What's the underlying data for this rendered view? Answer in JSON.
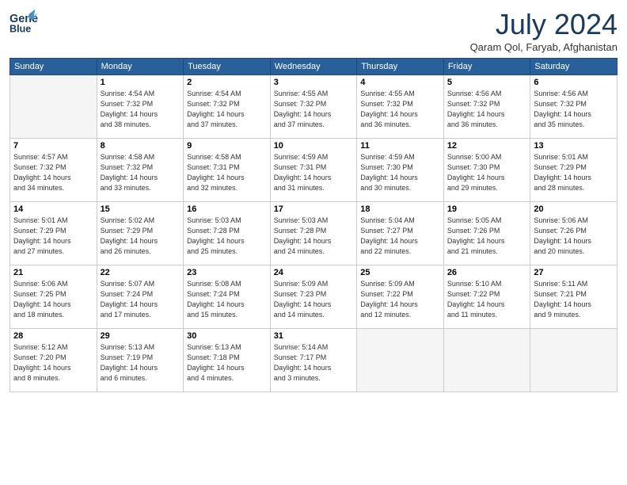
{
  "header": {
    "logo_top": "General",
    "logo_bottom": "Blue",
    "month_year": "July 2024",
    "location": "Qaram Qol, Faryab, Afghanistan"
  },
  "days_of_week": [
    "Sunday",
    "Monday",
    "Tuesday",
    "Wednesday",
    "Thursday",
    "Friday",
    "Saturday"
  ],
  "weeks": [
    [
      {
        "num": "",
        "info": ""
      },
      {
        "num": "1",
        "info": "Sunrise: 4:54 AM\nSunset: 7:32 PM\nDaylight: 14 hours\nand 38 minutes."
      },
      {
        "num": "2",
        "info": "Sunrise: 4:54 AM\nSunset: 7:32 PM\nDaylight: 14 hours\nand 37 minutes."
      },
      {
        "num": "3",
        "info": "Sunrise: 4:55 AM\nSunset: 7:32 PM\nDaylight: 14 hours\nand 37 minutes."
      },
      {
        "num": "4",
        "info": "Sunrise: 4:55 AM\nSunset: 7:32 PM\nDaylight: 14 hours\nand 36 minutes."
      },
      {
        "num": "5",
        "info": "Sunrise: 4:56 AM\nSunset: 7:32 PM\nDaylight: 14 hours\nand 36 minutes."
      },
      {
        "num": "6",
        "info": "Sunrise: 4:56 AM\nSunset: 7:32 PM\nDaylight: 14 hours\nand 35 minutes."
      }
    ],
    [
      {
        "num": "7",
        "info": "Sunrise: 4:57 AM\nSunset: 7:32 PM\nDaylight: 14 hours\nand 34 minutes."
      },
      {
        "num": "8",
        "info": "Sunrise: 4:58 AM\nSunset: 7:32 PM\nDaylight: 14 hours\nand 33 minutes."
      },
      {
        "num": "9",
        "info": "Sunrise: 4:58 AM\nSunset: 7:31 PM\nDaylight: 14 hours\nand 32 minutes."
      },
      {
        "num": "10",
        "info": "Sunrise: 4:59 AM\nSunset: 7:31 PM\nDaylight: 14 hours\nand 31 minutes."
      },
      {
        "num": "11",
        "info": "Sunrise: 4:59 AM\nSunset: 7:30 PM\nDaylight: 14 hours\nand 30 minutes."
      },
      {
        "num": "12",
        "info": "Sunrise: 5:00 AM\nSunset: 7:30 PM\nDaylight: 14 hours\nand 29 minutes."
      },
      {
        "num": "13",
        "info": "Sunrise: 5:01 AM\nSunset: 7:29 PM\nDaylight: 14 hours\nand 28 minutes."
      }
    ],
    [
      {
        "num": "14",
        "info": "Sunrise: 5:01 AM\nSunset: 7:29 PM\nDaylight: 14 hours\nand 27 minutes."
      },
      {
        "num": "15",
        "info": "Sunrise: 5:02 AM\nSunset: 7:29 PM\nDaylight: 14 hours\nand 26 minutes."
      },
      {
        "num": "16",
        "info": "Sunrise: 5:03 AM\nSunset: 7:28 PM\nDaylight: 14 hours\nand 25 minutes."
      },
      {
        "num": "17",
        "info": "Sunrise: 5:03 AM\nSunset: 7:28 PM\nDaylight: 14 hours\nand 24 minutes."
      },
      {
        "num": "18",
        "info": "Sunrise: 5:04 AM\nSunset: 7:27 PM\nDaylight: 14 hours\nand 22 minutes."
      },
      {
        "num": "19",
        "info": "Sunrise: 5:05 AM\nSunset: 7:26 PM\nDaylight: 14 hours\nand 21 minutes."
      },
      {
        "num": "20",
        "info": "Sunrise: 5:06 AM\nSunset: 7:26 PM\nDaylight: 14 hours\nand 20 minutes."
      }
    ],
    [
      {
        "num": "21",
        "info": "Sunrise: 5:06 AM\nSunset: 7:25 PM\nDaylight: 14 hours\nand 18 minutes."
      },
      {
        "num": "22",
        "info": "Sunrise: 5:07 AM\nSunset: 7:24 PM\nDaylight: 14 hours\nand 17 minutes."
      },
      {
        "num": "23",
        "info": "Sunrise: 5:08 AM\nSunset: 7:24 PM\nDaylight: 14 hours\nand 15 minutes."
      },
      {
        "num": "24",
        "info": "Sunrise: 5:09 AM\nSunset: 7:23 PM\nDaylight: 14 hours\nand 14 minutes."
      },
      {
        "num": "25",
        "info": "Sunrise: 5:09 AM\nSunset: 7:22 PM\nDaylight: 14 hours\nand 12 minutes."
      },
      {
        "num": "26",
        "info": "Sunrise: 5:10 AM\nSunset: 7:22 PM\nDaylight: 14 hours\nand 11 minutes."
      },
      {
        "num": "27",
        "info": "Sunrise: 5:11 AM\nSunset: 7:21 PM\nDaylight: 14 hours\nand 9 minutes."
      }
    ],
    [
      {
        "num": "28",
        "info": "Sunrise: 5:12 AM\nSunset: 7:20 PM\nDaylight: 14 hours\nand 8 minutes."
      },
      {
        "num": "29",
        "info": "Sunrise: 5:13 AM\nSunset: 7:19 PM\nDaylight: 14 hours\nand 6 minutes."
      },
      {
        "num": "30",
        "info": "Sunrise: 5:13 AM\nSunset: 7:18 PM\nDaylight: 14 hours\nand 4 minutes."
      },
      {
        "num": "31",
        "info": "Sunrise: 5:14 AM\nSunset: 7:17 PM\nDaylight: 14 hours\nand 3 minutes."
      },
      {
        "num": "",
        "info": ""
      },
      {
        "num": "",
        "info": ""
      },
      {
        "num": "",
        "info": ""
      }
    ]
  ]
}
